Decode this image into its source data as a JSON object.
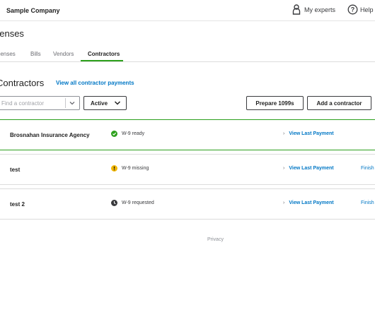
{
  "header": {
    "company": "Sample Company",
    "my_experts": "My experts",
    "help": "Help"
  },
  "page": {
    "title": "penses"
  },
  "tabs": [
    {
      "label": "penses"
    },
    {
      "label": "Bills"
    },
    {
      "label": "Vendors"
    },
    {
      "label": "Contractors",
      "active": true
    }
  ],
  "contractors_section": {
    "title": "Contractors",
    "view_all_link": "View all contractor payments"
  },
  "toolbar": {
    "search_placeholder": "Find a contractor",
    "filter_value": "Active",
    "prepare_button": "Prepare 1099s",
    "add_button": "Add a contractor"
  },
  "contractors": [
    {
      "name": "Brosnahan Insurance Agency",
      "status": "W-9 ready",
      "status_icon": "check-circle-icon",
      "action": "View Last Payment",
      "extra": ""
    },
    {
      "name": "test",
      "status": "W-9 missing",
      "status_icon": "warning-icon",
      "action": "View Last Payment",
      "extra": "Finish"
    },
    {
      "name": "test 2",
      "status": "W-9 requested",
      "status_icon": "clock-icon",
      "action": "View Last Payment",
      "extra": "Finish"
    }
  ],
  "colors": {
    "accent_green": "#2ca01c",
    "link_blue": "#0077c5",
    "warning_yellow": "#f2b705",
    "status_gray": "#393a3d"
  },
  "footer": {
    "privacy": "Privacy"
  }
}
